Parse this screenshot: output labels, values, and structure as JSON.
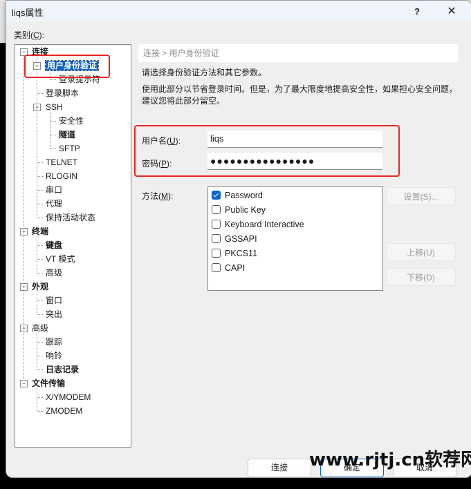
{
  "window": {
    "title": "liqs属性",
    "help_label": "?",
    "close_label": "✕"
  },
  "category_label": "类别(",
  "category_hotkey": "C",
  "category_suffix": "):",
  "tree": [
    {
      "label": "连接",
      "level": 0,
      "bold": true,
      "expander": "−"
    },
    {
      "label": "用户身份验证",
      "level": 1,
      "bold": true,
      "expander": "−",
      "selected": true
    },
    {
      "label": "登录提示符",
      "level": 2
    },
    {
      "label": "登录脚本",
      "level": 1
    },
    {
      "label": "SSH",
      "level": 1,
      "expander": "−"
    },
    {
      "label": "安全性",
      "level": 2
    },
    {
      "label": "隧道",
      "level": 2,
      "bold": true
    },
    {
      "label": "SFTP",
      "level": 2
    },
    {
      "label": "TELNET",
      "level": 1
    },
    {
      "label": "RLOGIN",
      "level": 1
    },
    {
      "label": "串口",
      "level": 1
    },
    {
      "label": "代理",
      "level": 1
    },
    {
      "label": "保持活动状态",
      "level": 1
    },
    {
      "label": "终端",
      "level": 0,
      "bold": true,
      "expander": "−"
    },
    {
      "label": "键盘",
      "level": 1,
      "bold": true
    },
    {
      "label": "VT 模式",
      "level": 1
    },
    {
      "label": "高级",
      "level": 1
    },
    {
      "label": "外观",
      "level": 0,
      "bold": true,
      "expander": "−"
    },
    {
      "label": "窗口",
      "level": 1
    },
    {
      "label": "突出",
      "level": 1
    },
    {
      "label": "高级",
      "level": 0,
      "expander": "−"
    },
    {
      "label": "跟踪",
      "level": 1
    },
    {
      "label": "响铃",
      "level": 1
    },
    {
      "label": "日志记录",
      "level": 1,
      "bold": true
    },
    {
      "label": "文件传输",
      "level": 0,
      "bold": true,
      "expander": "−"
    },
    {
      "label": "X/YMODEM",
      "level": 1
    },
    {
      "label": "ZMODEM",
      "level": 1
    }
  ],
  "panel": {
    "breadcrumb": "连接 > 用户身份验证",
    "description1": "请选择身份验证方法和其它参数。",
    "description2_line1": "使用此部分以节省登录时间。但是，为了最大限度地提高安全性，如果担心安全问题，",
    "description2_line2": "建议您将此部分留空。",
    "username_label_pre": "用户名(",
    "username_hotkey": "U",
    "username_label_post": "):",
    "username_value": "liqs",
    "password_label_pre": "密码(",
    "password_hotkey": "P",
    "password_label_post": "):",
    "password_value": "●●●●●●●●●●●●●●●●",
    "method_label_pre": "方法(",
    "method_hotkey": "M",
    "method_label_post": "):",
    "methods": [
      {
        "label": "Password",
        "checked": true
      },
      {
        "label": "Public Key",
        "checked": false
      },
      {
        "label": "Keyboard Interactive",
        "checked": false
      },
      {
        "label": "GSSAPI",
        "checked": false
      },
      {
        "label": "PKCS11",
        "checked": false
      },
      {
        "label": "CAPI",
        "checked": false
      }
    ],
    "settings_button": "设置(S)...",
    "move_up_button": "上移(U)",
    "move_down_button": "下移(D)"
  },
  "footer": {
    "connect_button": "连接",
    "ok_button": "确定",
    "cancel_button": "取消"
  },
  "watermark": "www.rjtj.cn软荐网",
  "colors": {
    "accent": "#0a64c8",
    "highlight_box": "#e8261e"
  }
}
